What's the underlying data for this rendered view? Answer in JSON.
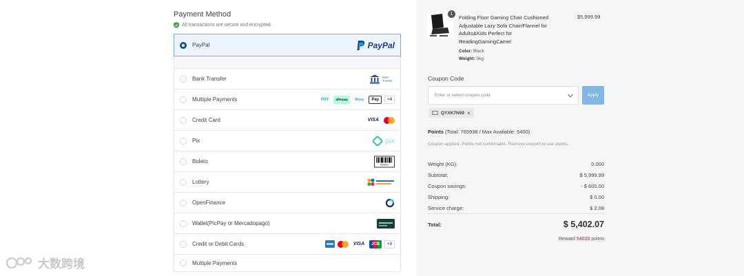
{
  "payment": {
    "title": "Payment Method",
    "secure_note": "All transactions are secure and encrypted.",
    "methods": [
      {
        "label": "PayPal",
        "selected": true,
        "logo_text": "PayPal"
      },
      {
        "label": "Bank Transfer",
        "logo_text": "Bank Transfer"
      },
      {
        "label": "Multiple Payments",
        "logos": [
          "PAY",
          "afterpay",
          "Alipay",
          "Pay",
          "+4"
        ]
      },
      {
        "label": "Credit Card",
        "logos": [
          "VISA",
          "mastercard"
        ]
      },
      {
        "label": "Pix",
        "logo_text": "pix"
      },
      {
        "label": "Boleto",
        "logo_text": "Boleto"
      },
      {
        "label": "Lottery"
      },
      {
        "label": "OpenFinance"
      },
      {
        "label": "Wallet(PicPay or Mercadopago)"
      },
      {
        "label": "Credit or Debit Cards",
        "logos": [
          "amex",
          "mastercard",
          "VISA",
          "JCB",
          "+3"
        ]
      },
      {
        "label": "Multiple Payments"
      }
    ]
  },
  "order": {
    "qty_badge": "1",
    "product_name": "Folding Floor Gaming Chair Cushioned Adjustable Lazy Sofa Chair/Flannel for Adults&Kids Perfect for ReadingGamingCamel",
    "color_label": "Color:",
    "color_value": "Black",
    "weight_label": "Weight:",
    "weight_value": "0kg",
    "price": "$5,999.99"
  },
  "coupon": {
    "heading": "Coupon Code",
    "placeholder": "Enter or select coupon code",
    "apply_label": "Apply",
    "applied_code": "QYXK7N59"
  },
  "points": {
    "label": "Points",
    "detail": "(Total: 765938 / Max Available: 5400)",
    "note": "Coupon applied. Points not combinable. Remove coupon to use points."
  },
  "summary": {
    "rows": [
      {
        "label": "Weight (KG):",
        "value": "0.000"
      },
      {
        "label": "Subtotal:",
        "value": "$ 5,999.99"
      },
      {
        "label": "Coupon savings:",
        "value": "- $ 600.00"
      },
      {
        "label": "Shipping:",
        "value": "$ 0.00"
      },
      {
        "label": "Service charge:",
        "value": "$ 2.08"
      }
    ],
    "total_label": "Total:",
    "total_value": "$ 5,402.07",
    "reward_prefix": "Reward",
    "reward_points": "54020",
    "reward_suffix": "points"
  },
  "watermark": {
    "text": "大数跨境"
  },
  "colors": {
    "accent": "#1f4f8f",
    "apply": "#84b6e4",
    "reward": "#d0021b",
    "panel": "#f5f6f7"
  }
}
